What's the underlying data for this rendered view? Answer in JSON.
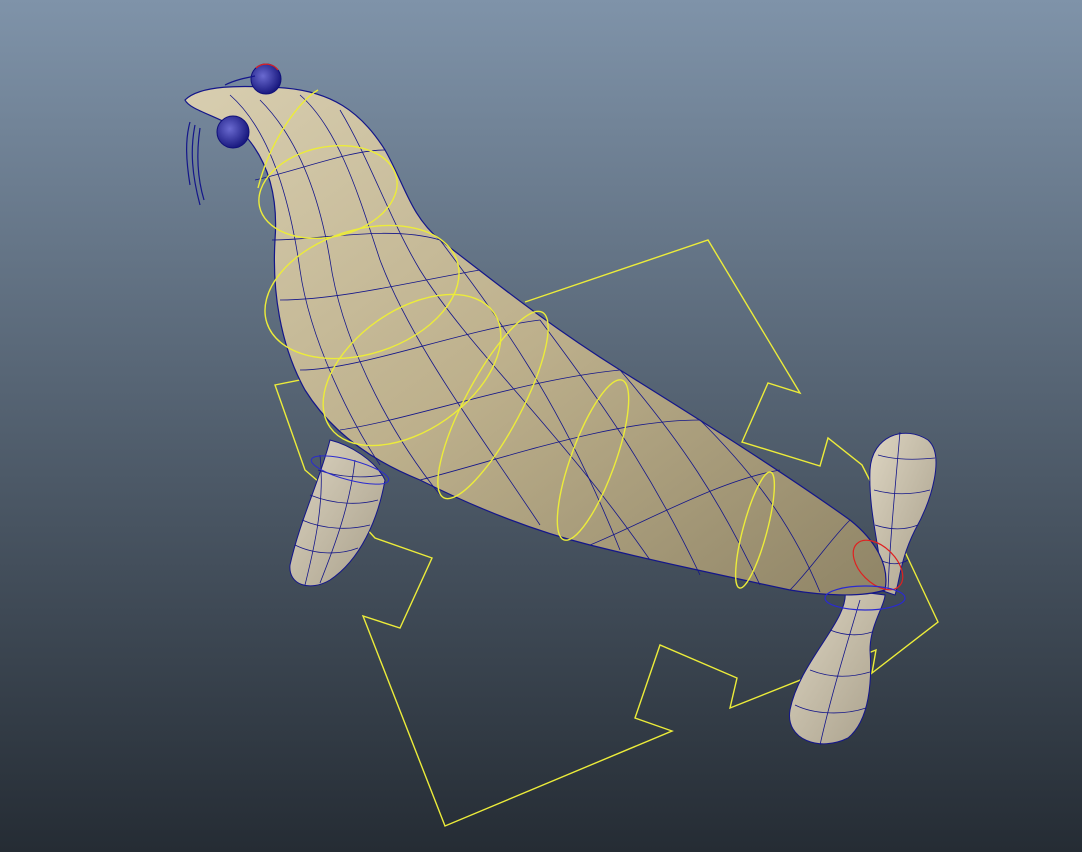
{
  "viewport": {
    "background_top": "#7f93a9",
    "background_bottom": "#252c34",
    "model_color": "#c9bd9c",
    "wire_color": "#14168a",
    "control_color": "#ecec3a",
    "selected_color": "#e02020"
  }
}
